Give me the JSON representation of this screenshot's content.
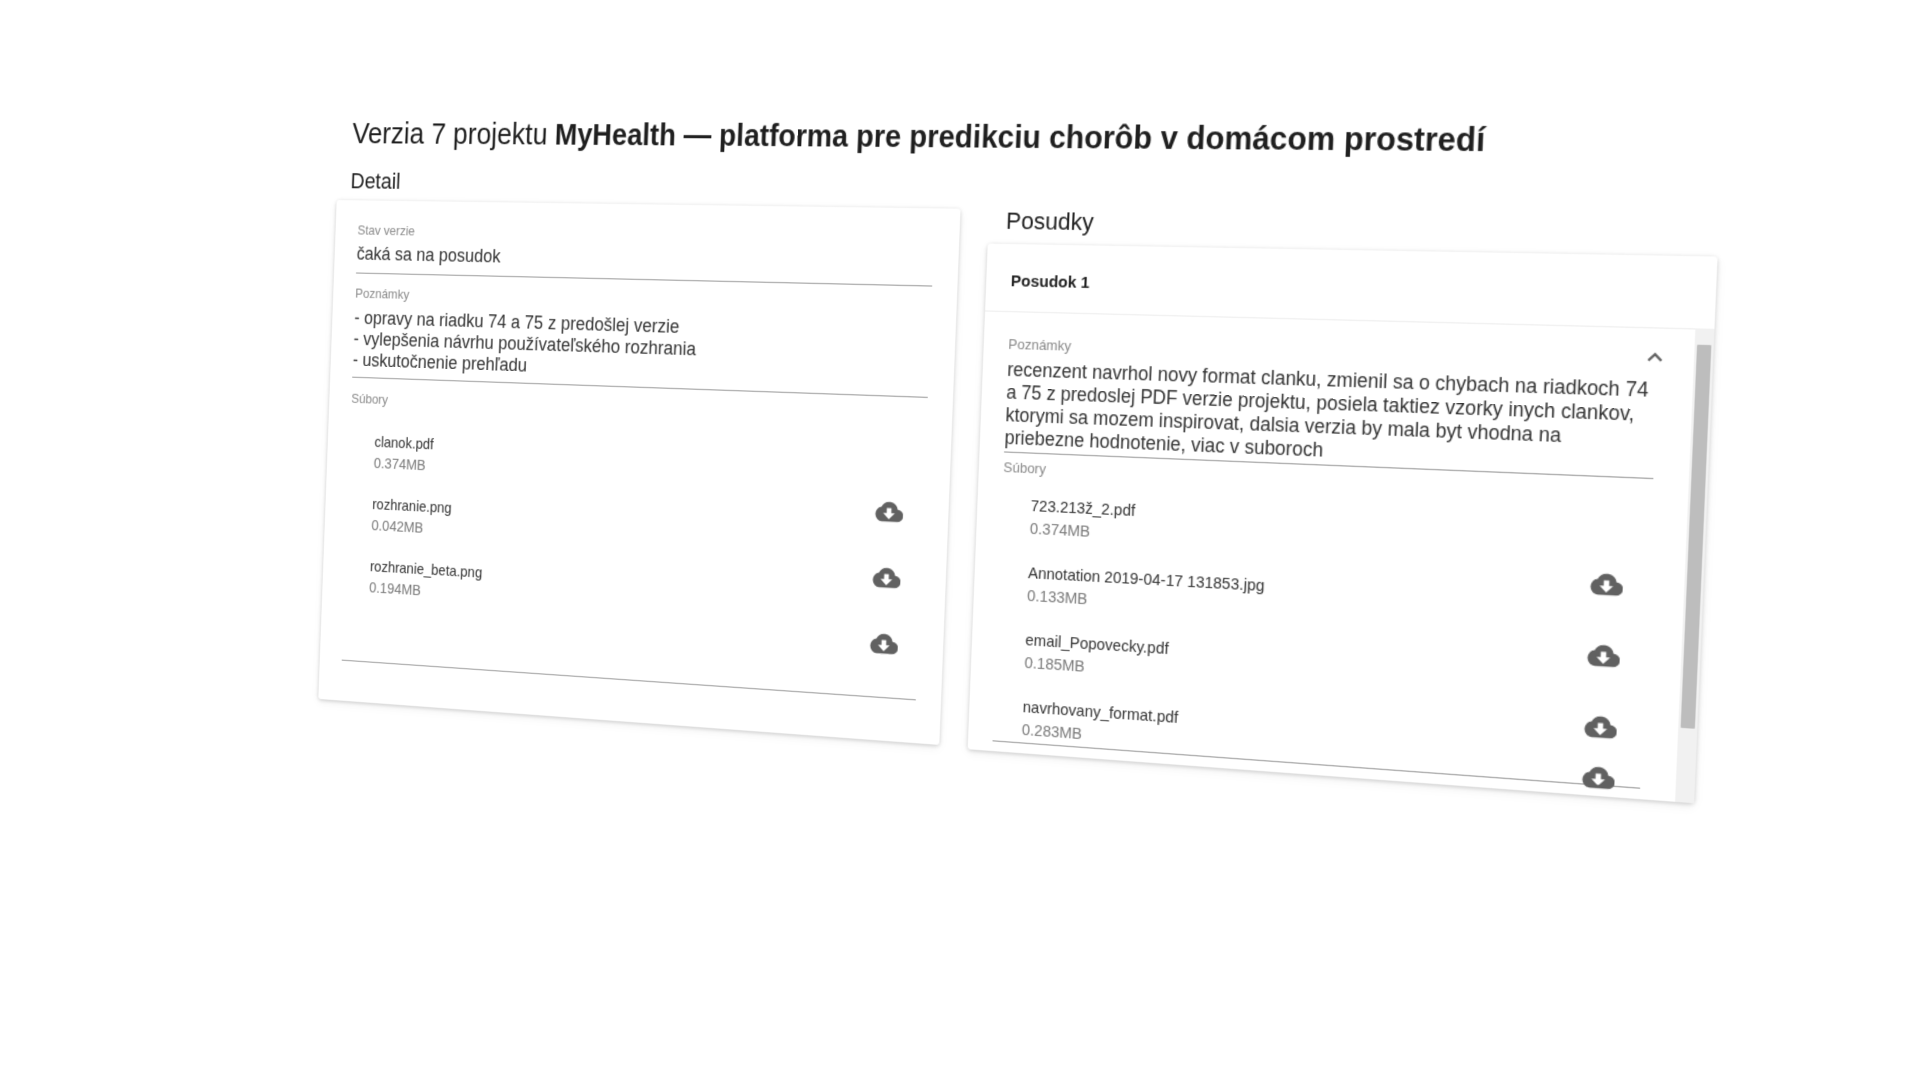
{
  "page": {
    "title_prefix": "Verzia 7 projektu",
    "title_project": "MyHealth — platforma pre predikciu chorôb v domácom prostredí"
  },
  "detail": {
    "section_title": "Detail",
    "status_label": "Stav verzie",
    "status_value": "čaká sa na posudok",
    "notes_label": "Poznámky",
    "notes_lines": [
      "- opravy na riadku 74 a 75 z predošlej verzie",
      "- vylepšenia návrhu používateľského rozhrania",
      "- uskutočnenie prehľadu"
    ],
    "files_label": "Súbory",
    "files": [
      {
        "name": "clanok.pdf",
        "size": "0.374MB"
      },
      {
        "name": "rozhranie.png",
        "size": "0.042MB"
      },
      {
        "name": "rozhranie_beta.png",
        "size": "0.194MB"
      }
    ]
  },
  "reviews": {
    "section_title": "Posudky",
    "items": [
      {
        "header": "Posudok 1",
        "notes_label": "Poznámky",
        "notes": "recenzent navrhol novy format clanku, zmienil sa o chybach na riadkoch 74 a 75 z predoslej PDF verzie projektu, posiela taktiez vzorky inych clankov, ktorymi sa mozem inspirovat, dalsia verzia by mala byt vhodna na priebezne hodnotenie, viac v suboroch",
        "files_label": "Súbory",
        "files": [
          {
            "name": "723.213ž_2.pdf",
            "size": "0.374MB"
          },
          {
            "name": "Annotation 2019-04-17 131853.jpg",
            "size": "0.133MB"
          },
          {
            "name": "email_Popovecky.pdf",
            "size": "0.185MB"
          },
          {
            "name": "navrhovany_format.pdf",
            "size": "0.283MB"
          }
        ]
      }
    ]
  },
  "icons": {
    "download": "cloud-download-icon",
    "collapse": "chevron-up-icon"
  },
  "colors": {
    "text": "#212121",
    "label": "#8a8a8a",
    "icon": "#616161"
  }
}
